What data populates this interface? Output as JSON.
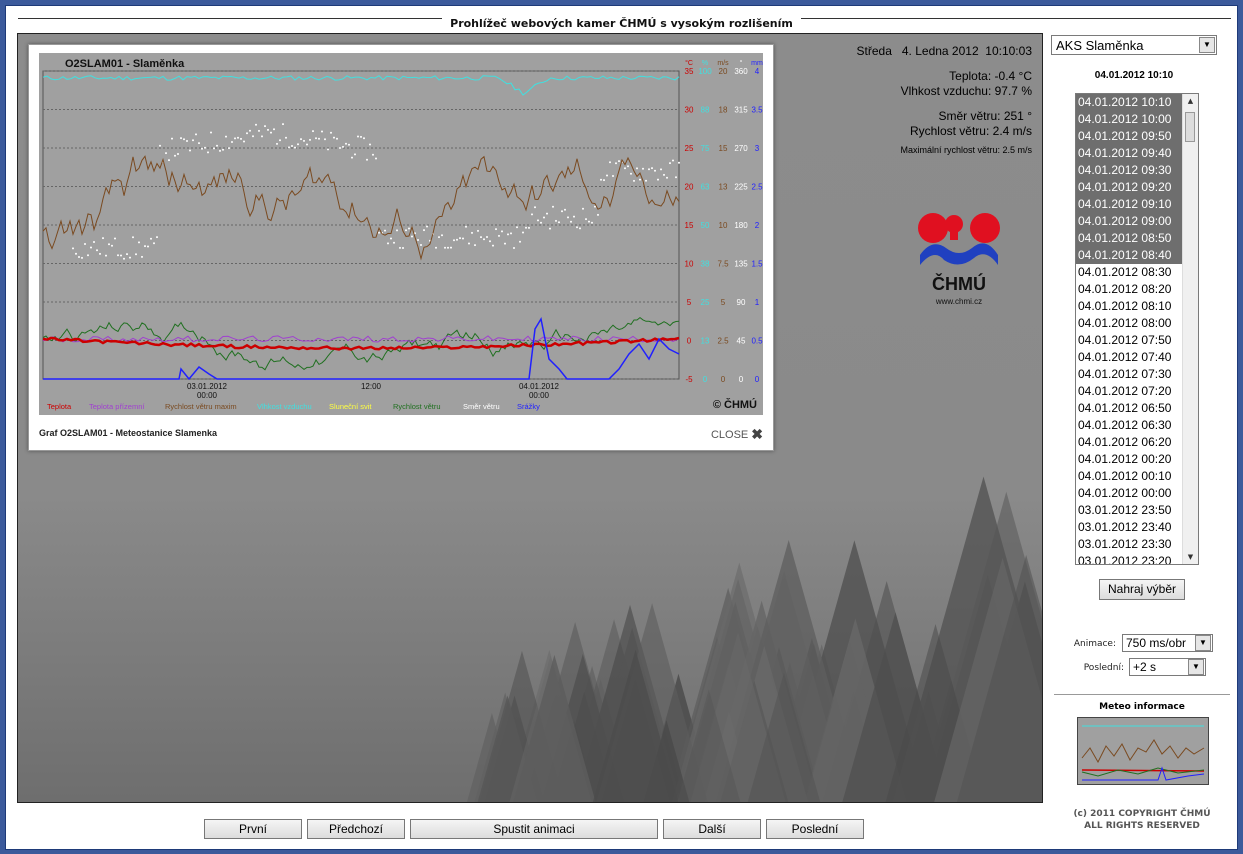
{
  "page": {
    "title": "Prohlížeč webových kamer ČHMÚ s vysokým rozlišením"
  },
  "camera": {
    "datetime": "Středa   4. Ledna 2012  10:10:03",
    "temperature": "Teplota: -0.4 °C",
    "humidity": "Vlhkost vzduchu: 97.7 %",
    "wind_dir": "Směr větru: 251 °",
    "wind_speed": "Rychlost větru: 2.4 m/s",
    "wind_max": "Maximální rychlost větru: 2.5 m/s",
    "logo_text": "ČHMÚ",
    "logo_url": "www.chmi.cz"
  },
  "popup": {
    "caption": "Graf O2SLAM01 - Meteostanice Slamenka",
    "close_label": "CLOSE"
  },
  "chart_data": {
    "type": "line",
    "title": "O2SLAM01 - Slaměnka",
    "copyright": "© ČHMÚ",
    "x_ticks": [
      "03.01.2012\n00:00",
      "12:00",
      "04.01.2012\n00:00"
    ],
    "axis_units": [
      "°C",
      "%",
      "m/s",
      "°",
      "mm"
    ],
    "axis_temp": [
      35,
      30,
      25,
      20,
      15,
      10,
      5,
      0,
      -5
    ],
    "axis_hum": [
      100,
      88,
      75,
      63,
      50,
      38,
      25,
      13,
      0
    ],
    "axis_wind": [
      20,
      18,
      15,
      13,
      10,
      7.5,
      5,
      2.5,
      0
    ],
    "axis_dir": [
      360,
      315,
      270,
      225,
      180,
      135,
      90,
      45,
      0
    ],
    "axis_rain": [
      4,
      3.5,
      3,
      2.5,
      2,
      1.5,
      1,
      0.5,
      0
    ],
    "legend": [
      {
        "name": "Teplota",
        "color": "#cc0000"
      },
      {
        "name": "Teplota přízemní",
        "color": "#a040d0"
      },
      {
        "name": "Rychlost větru maxim",
        "color": "#7a4a20"
      },
      {
        "name": "Vlhkost vzduchu",
        "color": "#40e0e0"
      },
      {
        "name": "Sluneční svit",
        "color": "#ffff40"
      },
      {
        "name": "Rychlost větru",
        "color": "#207020"
      },
      {
        "name": "Směr větru",
        "color": "#ffffff"
      },
      {
        "name": "Srážky",
        "color": "#2020ff"
      }
    ]
  },
  "sidebar": {
    "station": "AKS Slaměnka",
    "selected_time": "04.01.2012 10:10",
    "times": [
      "04.01.2012 10:10",
      "04.01.2012 10:00",
      "04.01.2012 09:50",
      "04.01.2012 09:40",
      "04.01.2012 09:30",
      "04.01.2012 09:20",
      "04.01.2012 09:10",
      "04.01.2012 09:00",
      "04.01.2012 08:50",
      "04.01.2012 08:40",
      "04.01.2012 08:30",
      "04.01.2012 08:20",
      "04.01.2012 08:10",
      "04.01.2012 08:00",
      "04.01.2012 07:50",
      "04.01.2012 07:40",
      "04.01.2012 07:30",
      "04.01.2012 07:20",
      "04.01.2012 06:50",
      "04.01.2012 06:30",
      "04.01.2012 06:20",
      "04.01.2012 00:20",
      "04.01.2012 00:10",
      "04.01.2012 00:00",
      "03.01.2012 23:50",
      "03.01.2012 23:40",
      "03.01.2012 23:30",
      "03.01.2012 23:20"
    ],
    "selected_count": 10,
    "load_button": "Nahraj výběr",
    "anim_label": "Animace:",
    "anim_value": "750 ms/obr",
    "last_label": "Poslední:",
    "last_value": "+2 s",
    "meteo_title": "Meteo informace",
    "copyright_1": "(c) 2011 COPYRIGHT ČHMÚ",
    "copyright_2": "ALL RIGHTS RESERVED"
  },
  "nav": {
    "first": "První",
    "prev": "Předchozí",
    "animate": "Spustit animaci",
    "next": "Další",
    "last": "Poslední"
  }
}
